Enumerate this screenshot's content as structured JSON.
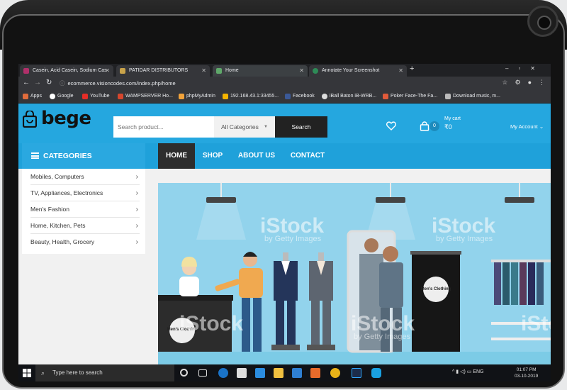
{
  "browser": {
    "tabs": [
      {
        "label": "Casein, Acid Casein, Sodium Cas",
        "active": false
      },
      {
        "label": "PATIDAR DISTRIBUTORS",
        "active": false
      },
      {
        "label": "Home",
        "active": true
      },
      {
        "label": "Annotate Your Screenshot",
        "active": false
      }
    ],
    "new_tab": "+",
    "url": "ecommerce.visioncodes.com/index.php/home",
    "bookmarks": [
      {
        "label": "Apps",
        "icon": "apps-icon"
      },
      {
        "label": "Google",
        "icon": "google-icon"
      },
      {
        "label": "YouTube",
        "icon": "youtube-icon"
      },
      {
        "label": "WAMPSERVER Ho...",
        "icon": "wamp-icon"
      },
      {
        "label": "phpMyAdmin",
        "icon": "phpmyadmin-icon"
      },
      {
        "label": "192.168.43.1:33455...",
        "icon": "server-icon"
      },
      {
        "label": "Facebook",
        "icon": "facebook-icon"
      },
      {
        "label": "iBall Baton iB-WRB...",
        "icon": "iball-icon"
      },
      {
        "label": "Poker Face-The Fa...",
        "icon": "music-icon"
      },
      {
        "label": "Download music, m...",
        "icon": "download-icon"
      }
    ]
  },
  "site": {
    "brand": "bege",
    "search": {
      "placeholder": "Search product...",
      "category": "All Categories",
      "button": "Search"
    },
    "cart": {
      "count": "0",
      "label": "My cart",
      "amount": "₹0"
    },
    "account": "My Account",
    "categories_title": "CATEGORIES",
    "menu": [
      "HOME",
      "SHOP",
      "ABOUT US",
      "CONTACT"
    ],
    "categories": [
      "Mobiles, Computers",
      "TV, Appliances, Electronics",
      "Men's Fashion",
      "Home, Kitchen, Pets",
      "Beauty, Health, Grocery"
    ],
    "banner": {
      "watermark": "iStock",
      "watermark_sub": "by Getty Images",
      "badge_text": "Men's Clothing"
    }
  },
  "taskbar": {
    "search_placeholder": "Type here to search",
    "language": "ENG",
    "time": "01:07 PM",
    "date": "03-10-2019"
  },
  "colors": {
    "header_blue": "#25a7df",
    "nav_blue": "#1fa1da",
    "menu_active": "#2d2d2d",
    "search_button": "#222222"
  }
}
